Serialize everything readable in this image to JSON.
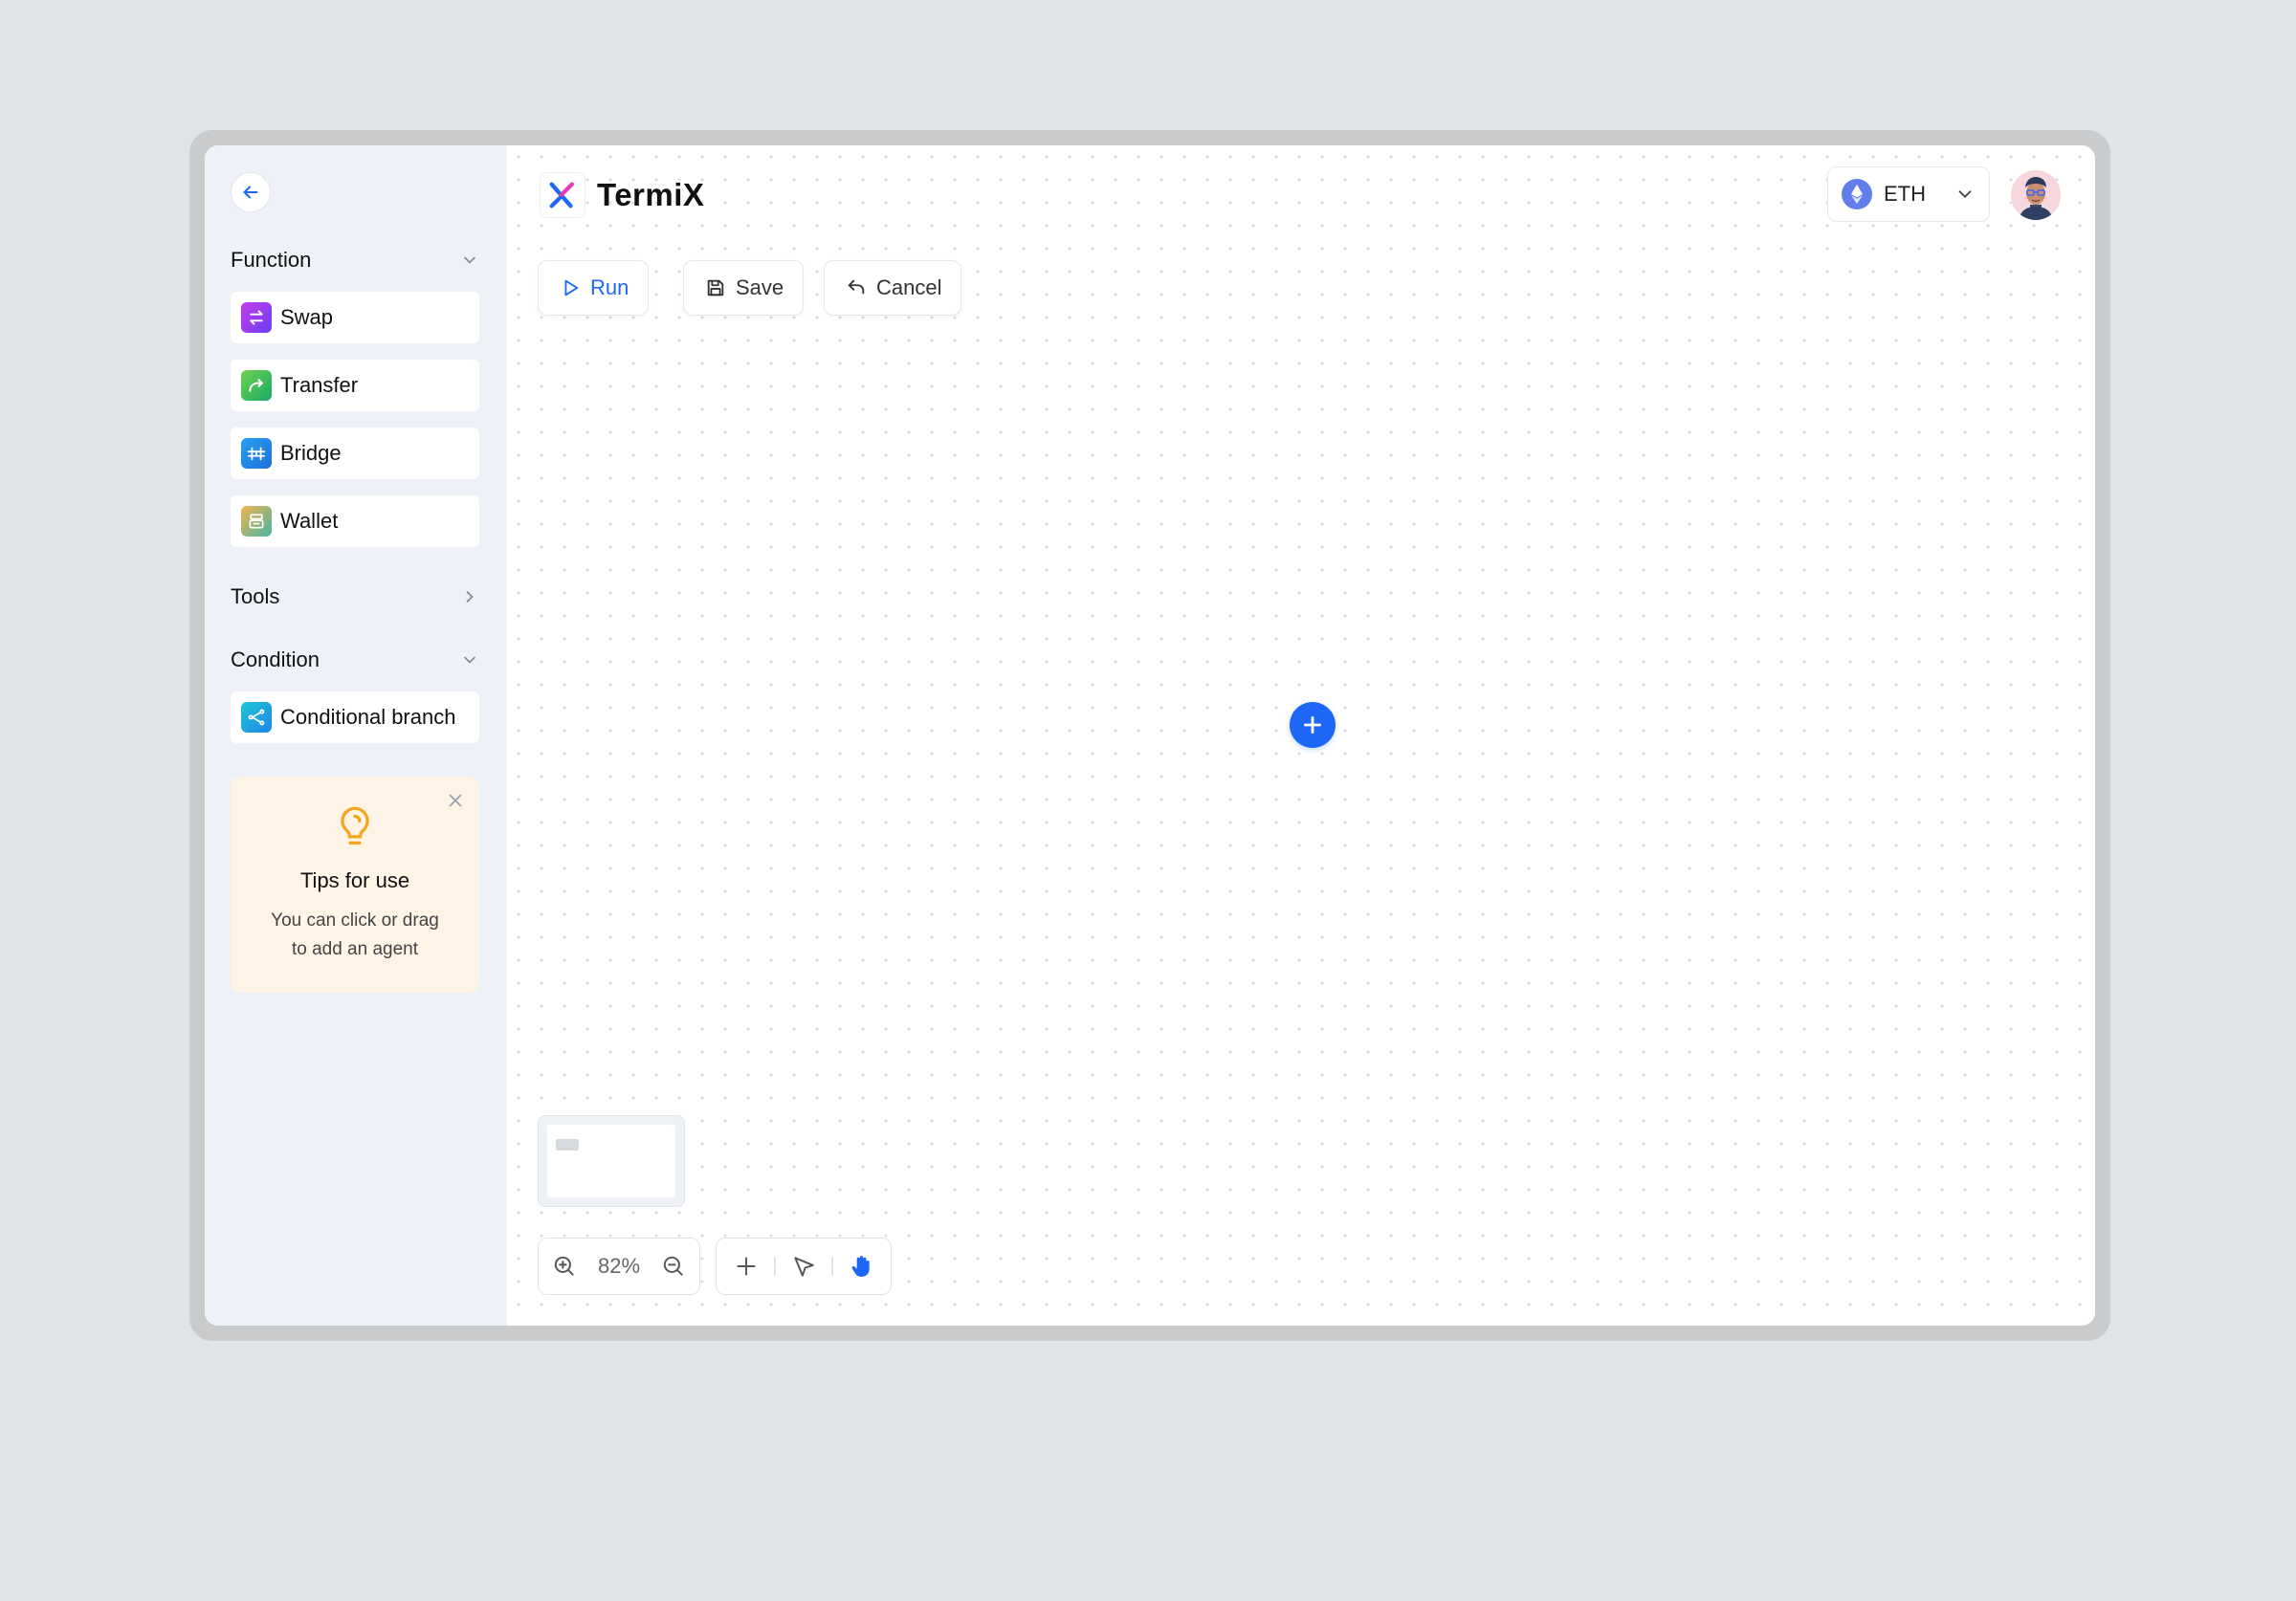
{
  "app": {
    "name": "TermiX"
  },
  "sidebar": {
    "sections": {
      "function": {
        "label": "Function",
        "expanded": true
      },
      "tools": {
        "label": "Tools",
        "expanded": false
      },
      "condition": {
        "label": "Condition",
        "expanded": true
      }
    },
    "function_items": [
      {
        "label": "Swap",
        "icon": "swap-icon",
        "color": "#8b3cf6"
      },
      {
        "label": "Transfer",
        "icon": "transfer-icon",
        "color": "#34b95a"
      },
      {
        "label": "Bridge",
        "icon": "bridge-icon",
        "color": "#2186e8"
      },
      {
        "label": "Wallet",
        "icon": "wallet-icon",
        "color": "#e0a34a"
      }
    ],
    "condition_items": [
      {
        "label": "Conditional branch",
        "icon": "branch-icon",
        "color": "#16a9d9"
      }
    ]
  },
  "tips": {
    "title": "Tips for use",
    "line1": "You can click or drag",
    "line2": "to add an agent"
  },
  "toolbar": {
    "run_label": "Run",
    "save_label": "Save",
    "cancel_label": "Cancel"
  },
  "network": {
    "label": "ETH"
  },
  "zoom": {
    "level": "82%"
  },
  "colors": {
    "accent": "#1e66f5",
    "sidebar_bg": "#eef2f8",
    "tips_bg": "#fdf4e6",
    "eth": "#627eea"
  }
}
